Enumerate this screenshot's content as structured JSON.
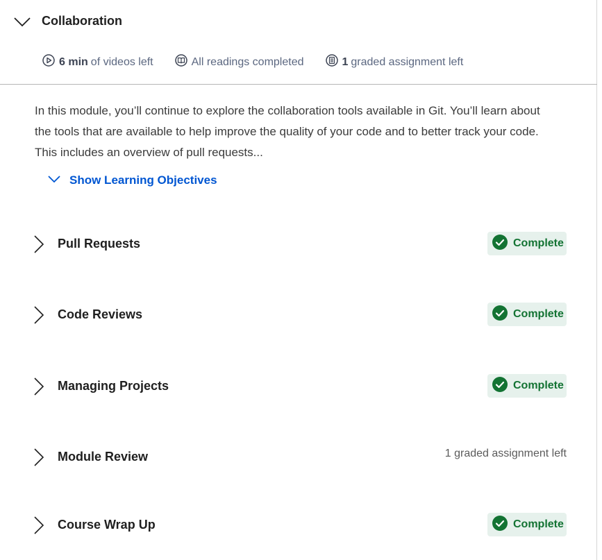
{
  "module": {
    "title": "Collaboration",
    "meta": {
      "videos": {
        "strong": "6 min",
        "text": "of videos left",
        "icon": "play-circle-icon"
      },
      "readings": {
        "text": "All readings completed",
        "icon": "book-icon"
      },
      "assignments": {
        "strong": "1",
        "text": "graded assignment left",
        "icon": "assignment-icon"
      }
    },
    "description": "In this module, you’ll continue to explore the collaboration tools available in Git. You’ll learn about the tools that are available to help improve the quality of your code and to better track your code. This includes an overview of pull requests...",
    "objectives_label": "Show Learning Objectives"
  },
  "lessons": [
    {
      "title": "Pull Requests",
      "status": "Complete"
    },
    {
      "title": "Code Reviews",
      "status": "Complete"
    },
    {
      "title": "Managing Projects",
      "status": "Complete"
    },
    {
      "title": "Module Review",
      "status": "1 graded assignment left"
    },
    {
      "title": "Course Wrap Up",
      "status": "Complete"
    }
  ],
  "colors": {
    "accent_link": "#0056d2",
    "complete_green": "#137333",
    "complete_bg": "#e6f1ec"
  }
}
